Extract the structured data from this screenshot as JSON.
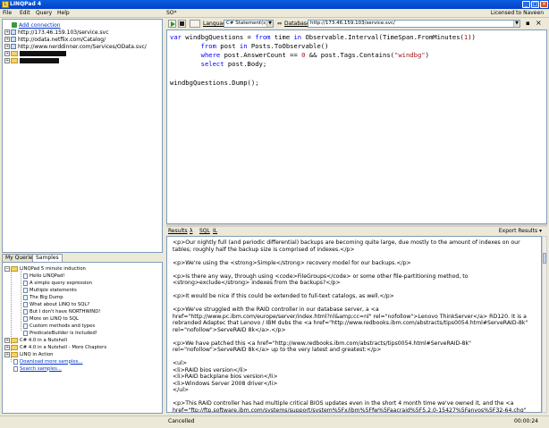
{
  "window": {
    "title": "LINQPad 4"
  },
  "menu": {
    "items": [
      "File",
      "Edit",
      "Query",
      "Help"
    ],
    "licensed": "Licensed to Naveen"
  },
  "connections": {
    "add": "Add connection",
    "items": [
      "http://173.46.159.103/service.svc",
      "http://odata.netflix.com/Catalog/",
      "http://www.nerddinner.com/Services/OData.svc/"
    ]
  },
  "left_tabs": [
    "My Queries",
    "Samples"
  ],
  "samples": {
    "root": "LINQPad 5 minute induction",
    "children": [
      "Hello LINQPad!",
      "A simple query expression",
      "Multiple statements",
      "The Big Dump",
      "What about LINQ to SQL?",
      "But I don't have NORTHWIND!",
      "More on LINQ to SQL",
      "Custom methods and types",
      "PredicateBuilder is Included!"
    ],
    "folders": [
      "C# 4.0 in a Nutshell",
      "C# 4.0 in a Nutshell - More Chapters",
      "LINQ in Action"
    ],
    "download": "Download more samples...",
    "search": "Search samples..."
  },
  "query": {
    "tab": "SO*",
    "language_label": "Language",
    "language_value": "C# Statement(s)",
    "database_label": "Database",
    "database_value": "http://173.46.159.103/service.svc/",
    "code": [
      "var windbgQuestions = from time in Observable.Interval(TimeSpan.FromMinutes(1))",
      "        from post in Posts.ToObservable()",
      "        where post.AnswerCount == 0 && post.Tags.Contains(\"windbg\")",
      "        select post.Body;",
      "",
      "windbgQuestions.Dump();"
    ]
  },
  "results_tabs": {
    "results": "Results",
    "lambda": "λ",
    "sql": "SQL",
    "il": "IL",
    "export": "Export Results"
  },
  "results": [
    "<p>Our nightly full (and periodic differential) backups are becoming quite large, due mostly to the amount of indexes on our",
    "tables; roughly half the backup size is comprised of indexes.</p>",
    "",
    "<p>We're using the <strong>Simple</strong> recovery model for our backups.</p>",
    "",
    "<p>Is there any way, through using <code>FileGroups</code> or some other file-partitioning method, to",
    "<strong>exclude</strong> indexes from the backups?</p>",
    "",
    "<p>It would be nice if this could be extended to full-text catalogs, as well.</p>",
    "",
    "<p>We've struggled with the RAID controller in our database server, a <a",
    "href=\"http://www.pc.ibm.com/europe/server/index.html?nl&amp;cc=nl\" rel=\"nofollow\">Lenovo ThinkServer</a> RD120. It is a",
    "rebranded Adaptec that Lenovo / IBM dubs the <a href=\"http://www.redbooks.ibm.com/abstracts/tips0054.html#ServeRAID-8k\"",
    "rel=\"nofollow\">ServeRAID 8k</a>.</p>",
    "",
    "<p>We have patched this <a href=\"http://www.redbooks.ibm.com/abstracts/tips0054.html#ServeRAID-8k\"",
    "rel=\"nofollow\">ServeRAID 8k</a> up to the very latest and greatest:</p>",
    "",
    "<ul>",
    "<li>RAID bios version</li>",
    "<li>RAID backplane bios version</li>",
    "<li>Windows Server 2008 driver</li>",
    "</ul>",
    "",
    "<p>This RAID controller has had multiple critical BIOS updates even in the short 4 month time we've owned it, and the <a",
    "href=\"ftp://ftp.software.ibm.com/systems/support/system%5Fx/ibm%5Ffw%5Faacraid%5F5.2.0-15427%5Fanyos%5F32-64.chg\""
  ],
  "status": {
    "text": "Cancelled",
    "time": "00:00:24"
  }
}
